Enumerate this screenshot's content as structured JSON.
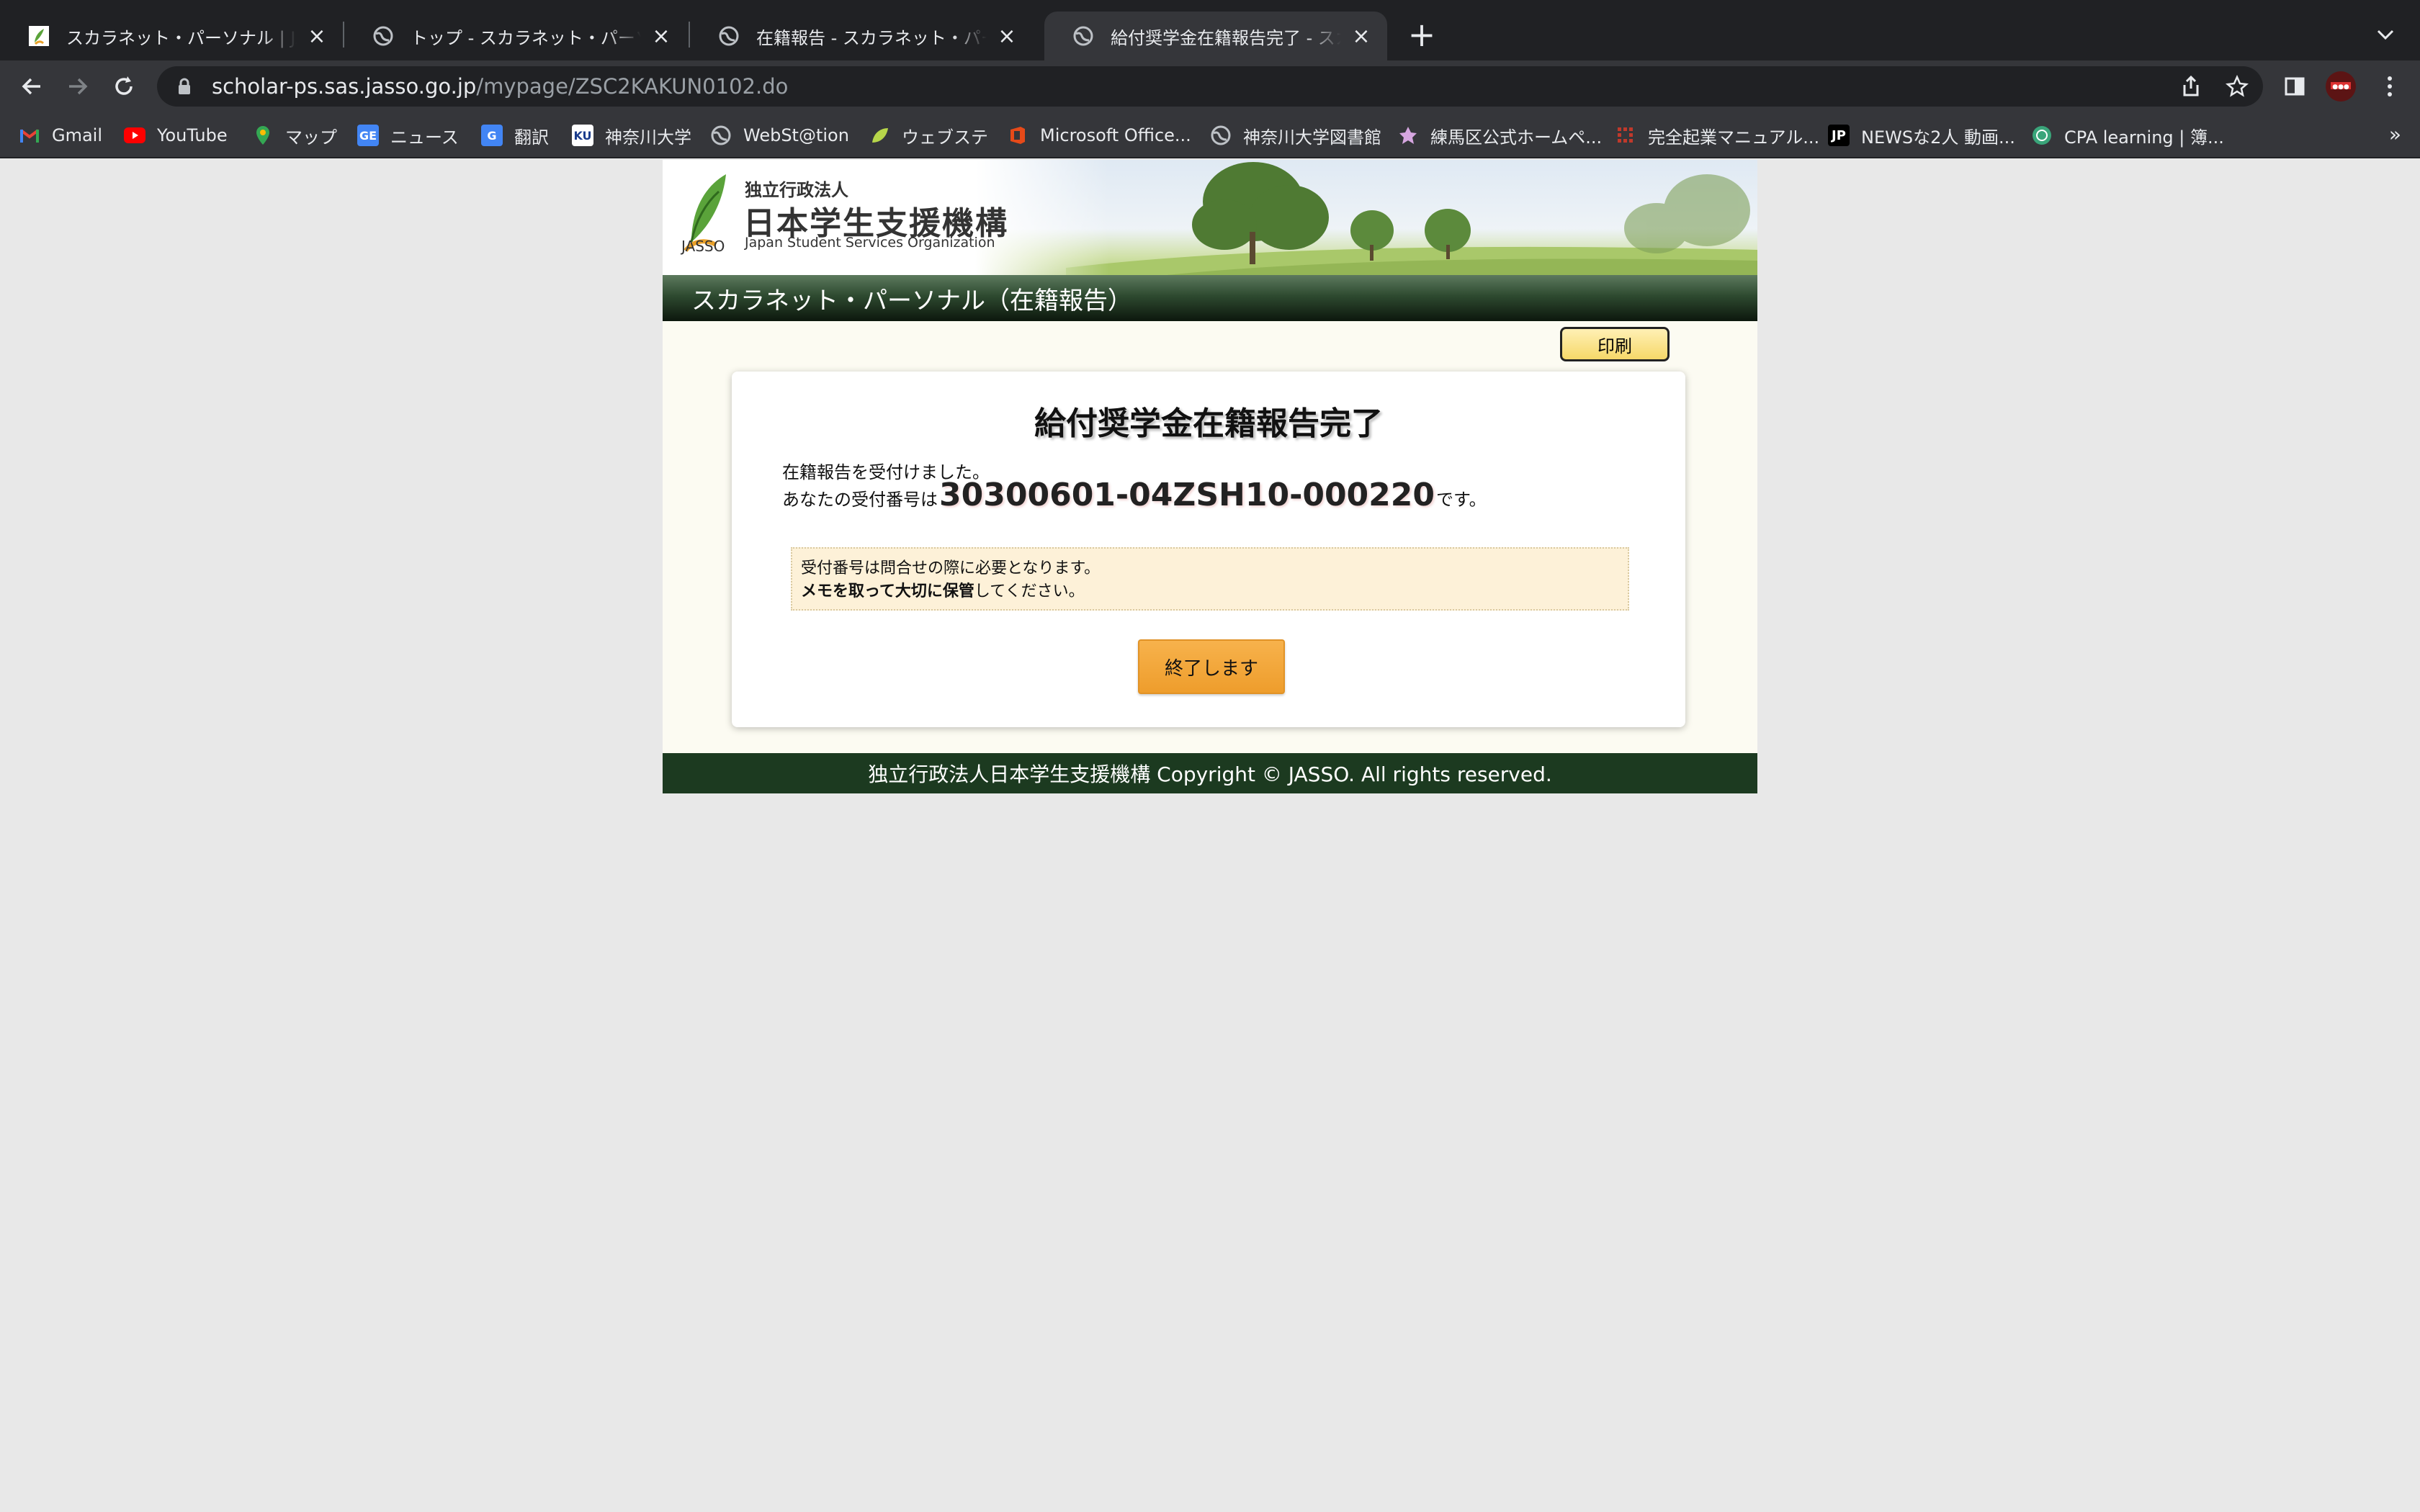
{
  "browser": {
    "tabs": [
      {
        "title": "スカラネット・パーソナル | JASSO",
        "icon": "jasso-favicon"
      },
      {
        "title": "トップ - スカラネット・パーソナル",
        "icon": "globe-icon"
      },
      {
        "title": "在籍報告 - スカラネット・パーソナル",
        "icon": "globe-icon"
      },
      {
        "title": "給付奨学金在籍報告完了 - スカラネット",
        "icon": "globe-icon",
        "active": true
      }
    ],
    "url_host": "scholar-ps.sas.jasso.go.jp",
    "url_path": "/mypage/ZSC2KAKUN0102.do",
    "bookmarks": [
      {
        "label": "Gmail",
        "icon": "gmail-icon"
      },
      {
        "label": "YouTube",
        "icon": "youtube-icon"
      },
      {
        "label": "マップ",
        "icon": "maps-icon"
      },
      {
        "label": "ニュース",
        "icon": "news-icon"
      },
      {
        "label": "翻訳",
        "icon": "translate-icon"
      },
      {
        "label": "神奈川大学",
        "icon": "ku-icon"
      },
      {
        "label": "WebSt@tion",
        "icon": "globe-icon"
      },
      {
        "label": "ウェブステ",
        "icon": "leaf-icon"
      },
      {
        "label": "Microsoft Office...",
        "icon": "office-icon"
      },
      {
        "label": "神奈川大学図書館",
        "icon": "globe-icon"
      },
      {
        "label": "練馬区公式ホームペ...",
        "icon": "nerima-icon"
      },
      {
        "label": "完全起業マニュアル...",
        "icon": "grid-icon"
      },
      {
        "label": "NEWSな2人 動画...",
        "icon": "jp-icon"
      },
      {
        "label": "CPA learning | 簿...",
        "icon": "cpa-icon"
      }
    ],
    "bookmarks_more": "»"
  },
  "header": {
    "org_small": "独立行政法人",
    "org_name": "日本学生支援機構",
    "org_en": "Japan Student Services Organization",
    "logo_text": "JASSO",
    "title": "スカラネット・パーソナル（在籍報告）"
  },
  "print_button": "印刷",
  "main": {
    "heading": "給付奨学金在籍報告完了",
    "received_msg": "在籍報告を受付けました。",
    "number_prefix": "あなたの受付番号は",
    "receipt_number": "30300601-04ZSH10-000220",
    "number_suffix": "です。",
    "notice_line1": "受付番号は問合せの際に必要となります。",
    "notice_bold": "メモを取って大切に保管",
    "notice_line2_rest": "してください。",
    "end_button": "終了します"
  },
  "footer": {
    "copyright": "独立行政法人日本学生支援機構 Copyright © JASSO. All rights reserved."
  }
}
